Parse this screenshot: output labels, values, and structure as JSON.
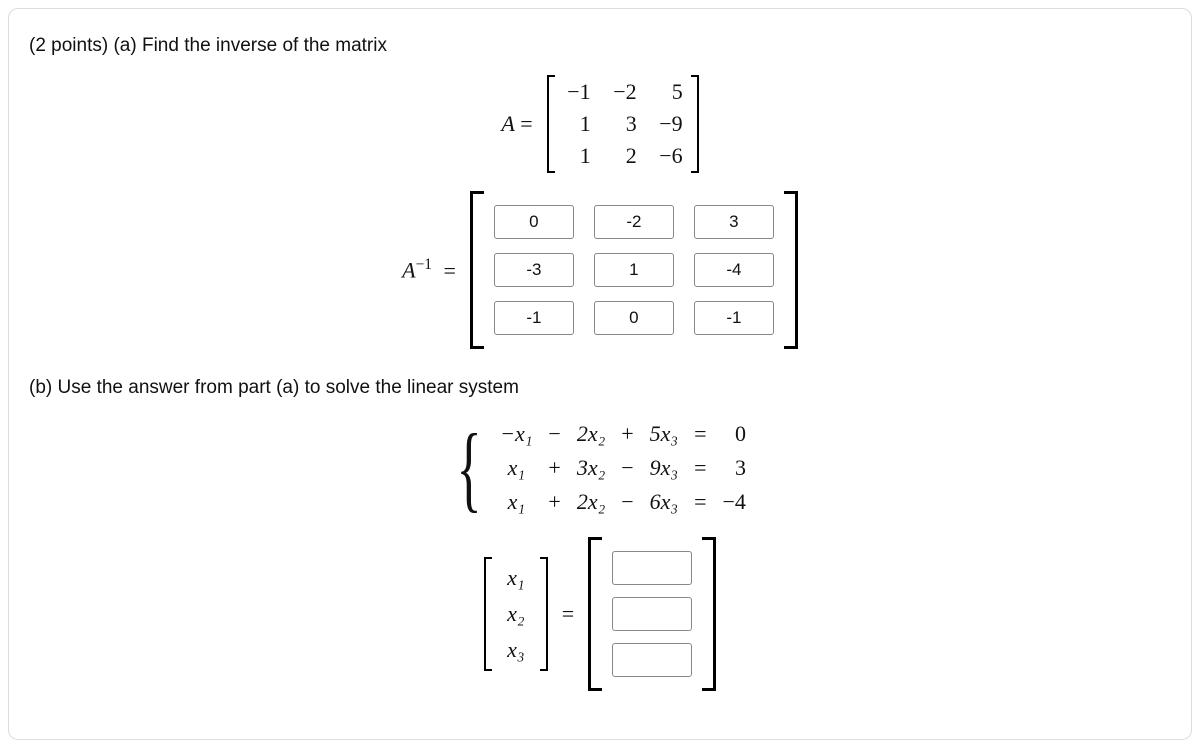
{
  "partA": {
    "prompt": "(2 points) (a) Find the inverse of the matrix",
    "A_label": "A",
    "equals": "=",
    "A": [
      [
        "−1",
        "−2",
        "5"
      ],
      [
        "1",
        "3",
        "−9"
      ],
      [
        "1",
        "2",
        "−6"
      ]
    ],
    "Ainv_label_A": "A",
    "Ainv_label_exp": "−1",
    "Ainv_values": [
      [
        "0",
        "-2",
        "3"
      ],
      [
        "-3",
        "1",
        "-4"
      ],
      [
        "-1",
        "0",
        "-1"
      ]
    ]
  },
  "partB": {
    "prompt": "(b) Use the answer from part (a) to solve the linear system",
    "system": {
      "r1": {
        "c1": "−x₁",
        "op1": "−",
        "c2": "2x₂",
        "op2": "+",
        "c3": "5x₃",
        "eq": "=",
        "rhs": "0"
      },
      "r2": {
        "c1": "x₁",
        "op1": "+",
        "c2": "3x₂",
        "op2": "−",
        "c3": "9x₃",
        "eq": "=",
        "rhs": "3"
      },
      "r3": {
        "c1": "x₁",
        "op1": "+",
        "c2": "2x₂",
        "op2": "−",
        "c3": "6x₃",
        "eq": "=",
        "rhs": "−4"
      }
    },
    "xvec": [
      "x₁",
      "x₂",
      "x₃"
    ],
    "equals": "=",
    "answers": [
      "",
      "",
      ""
    ]
  }
}
